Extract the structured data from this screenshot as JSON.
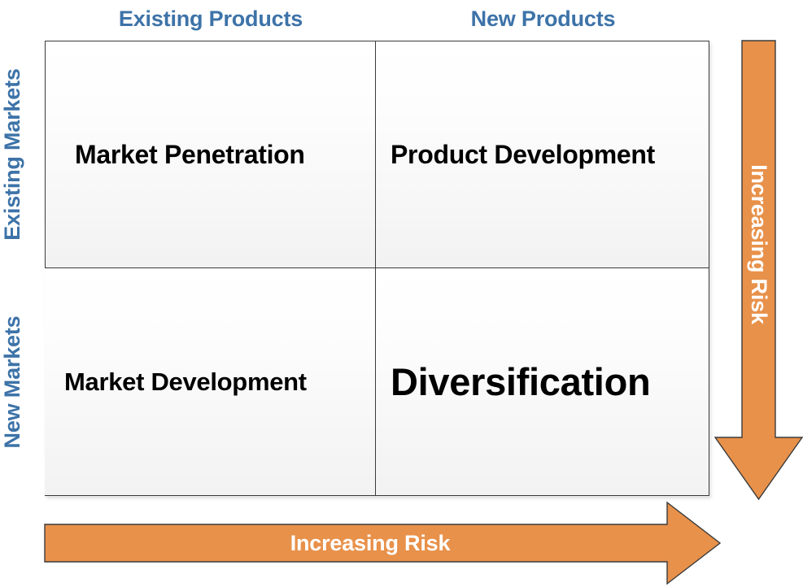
{
  "diagram": {
    "type": "ansoff-matrix",
    "column_headers": [
      {
        "label": "Existing Products"
      },
      {
        "label": "New Products"
      }
    ],
    "row_headers": [
      {
        "label": "Existing Markets"
      },
      {
        "label": "New Markets"
      }
    ],
    "quadrants": [
      {
        "label": "Market Penetration",
        "row": "Existing Markets",
        "column": "Existing Products"
      },
      {
        "label": "Product Development",
        "row": "Existing Markets",
        "column": "New Products"
      },
      {
        "label": "Market Development",
        "row": "New Markets",
        "column": "Existing Products"
      },
      {
        "label": "Diversification",
        "row": "New Markets",
        "column": "New Products"
      }
    ],
    "arrows": [
      {
        "label": "Increasing Risk",
        "direction": "down"
      },
      {
        "label": "Increasing Risk",
        "direction": "right"
      }
    ],
    "colors": {
      "header_blue": "#3D73A8",
      "arrow_orange": "#E8914A",
      "arrow_outline": "#3b3b3b",
      "arrow_text": "#ffffff",
      "cell_text": "#000000",
      "cell_border": "#3b3b3b"
    }
  }
}
